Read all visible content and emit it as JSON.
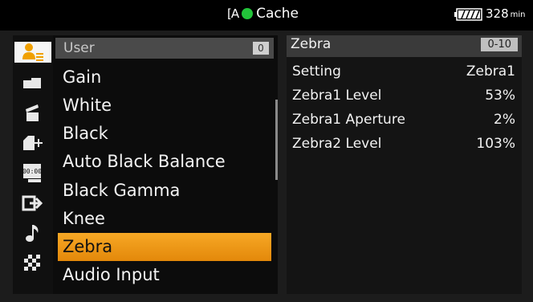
{
  "status_bar": {
    "media_icon": "A",
    "cache_label": "Cache",
    "cache_indicator_color": "#22c43a",
    "battery_label": "328",
    "battery_unit": "min"
  },
  "icon_rail": [
    {
      "name": "user-menu-icon",
      "active": true
    },
    {
      "name": "camera-icon",
      "active": false
    },
    {
      "name": "clapperboard-icon",
      "active": false
    },
    {
      "name": "media-add-icon",
      "active": false
    },
    {
      "name": "timecode-icon",
      "active": false
    },
    {
      "name": "output-icon",
      "active": false
    },
    {
      "name": "audio-note-icon",
      "active": false
    },
    {
      "name": "checker-icon",
      "active": false
    }
  ],
  "menu": {
    "header": {
      "label": "User",
      "badge": "0"
    },
    "items": [
      {
        "label": "Gain"
      },
      {
        "label": "White"
      },
      {
        "label": "Black"
      },
      {
        "label": "Auto Black Balance"
      },
      {
        "label": "Black Gamma"
      },
      {
        "label": "Knee"
      },
      {
        "label": "Zebra"
      },
      {
        "label": "Audio Input"
      }
    ],
    "selected_index": 6
  },
  "detail": {
    "title": "Zebra",
    "range": "0-10",
    "rows": [
      {
        "label": "Setting",
        "value": "Zebra1"
      },
      {
        "label": "Zebra1 Level",
        "value": "53%"
      },
      {
        "label": "Zebra1 Aperture",
        "value": "2%"
      },
      {
        "label": "Zebra2 Level",
        "value": "103%"
      }
    ]
  },
  "colors": {
    "accent": "#f0a000",
    "selection": "#f7a825"
  }
}
